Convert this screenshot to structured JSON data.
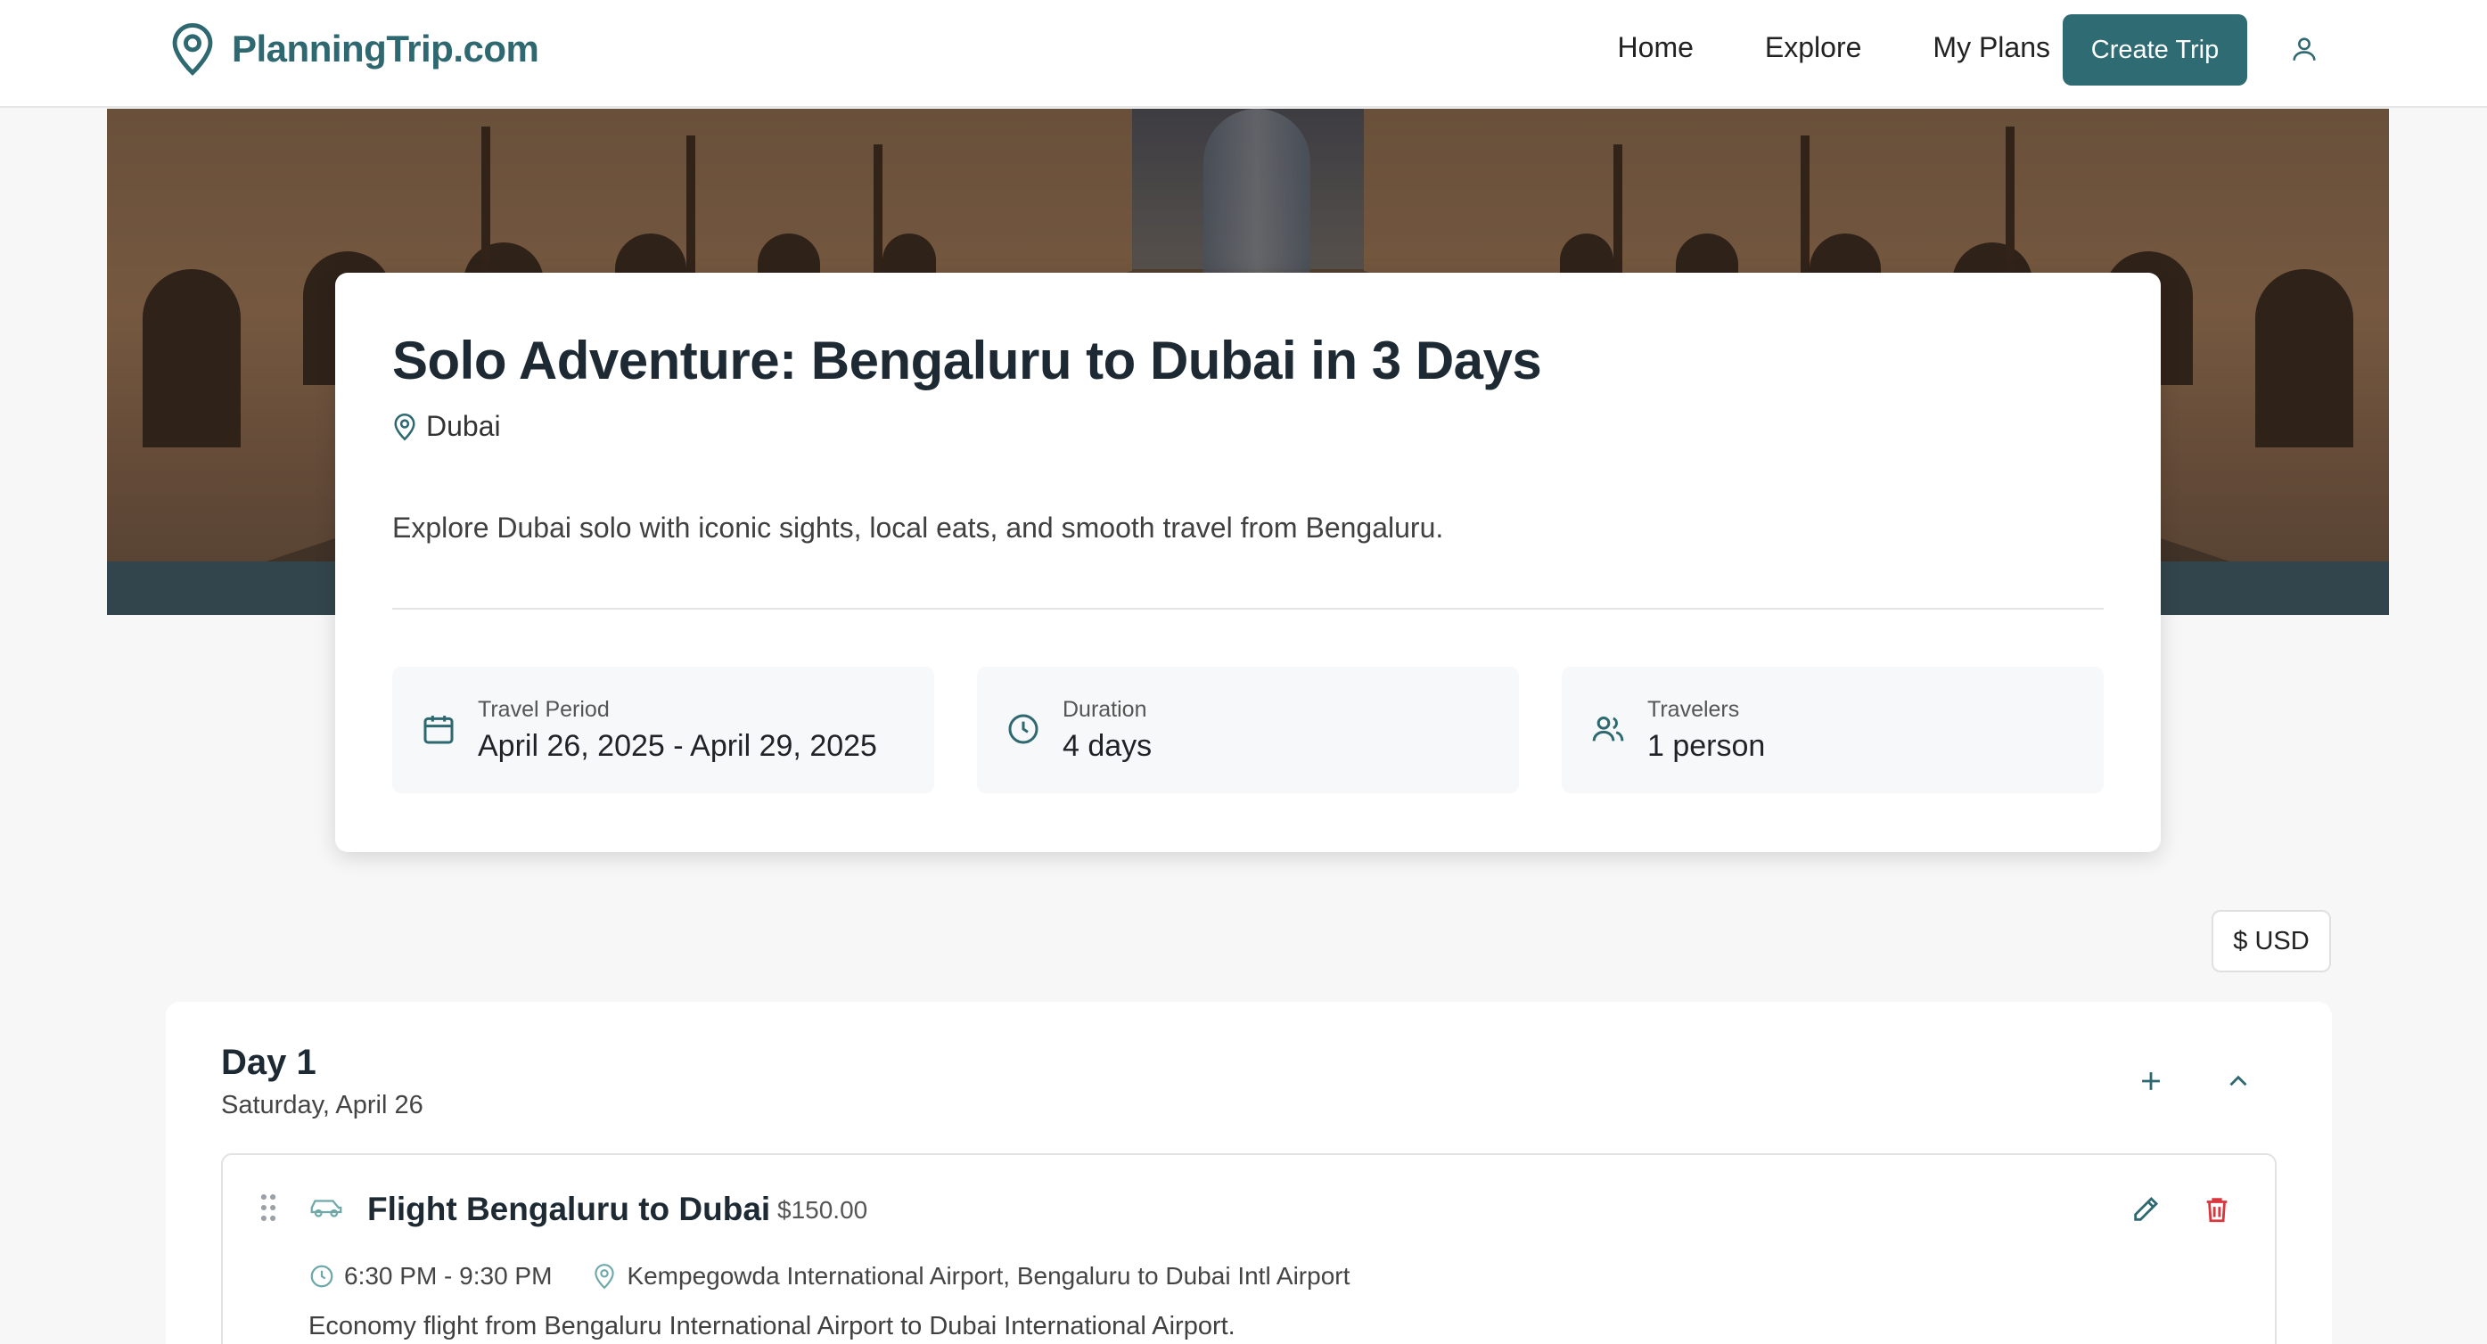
{
  "nav": {
    "brand": "PlanningTrip.com",
    "links": [
      "Home",
      "Explore",
      "My Plans"
    ],
    "create_label": "Create Trip"
  },
  "trip": {
    "title": "Solo Adventure: Bengaluru to Dubai in 3 Days",
    "location": "Dubai",
    "description": "Explore Dubai solo with iconic sights, local eats, and smooth travel from Bengaluru.",
    "stats": [
      {
        "label": "Travel Period",
        "value": "April 26, 2025 - April 29, 2025",
        "icon": "calendar-icon"
      },
      {
        "label": "Duration",
        "value": "4 days",
        "icon": "clock-icon"
      },
      {
        "label": "Travelers",
        "value": "1 person",
        "icon": "users-icon"
      }
    ]
  },
  "currency": "$ USD",
  "day": {
    "title": "Day 1",
    "date": "Saturday, April 26",
    "activity": {
      "title": "Flight Bengaluru to Dubai",
      "price": "$150.00",
      "time": "6:30 PM - 9:30 PM",
      "place": "Kempegowda International Airport, Bengaluru to Dubai Intl Airport",
      "description": "Economy flight from Bengaluru International Airport to Dubai International Airport."
    }
  },
  "colors": {
    "brand": "#2e6870",
    "button": "#2e6b72",
    "delete": "#d9363e"
  }
}
